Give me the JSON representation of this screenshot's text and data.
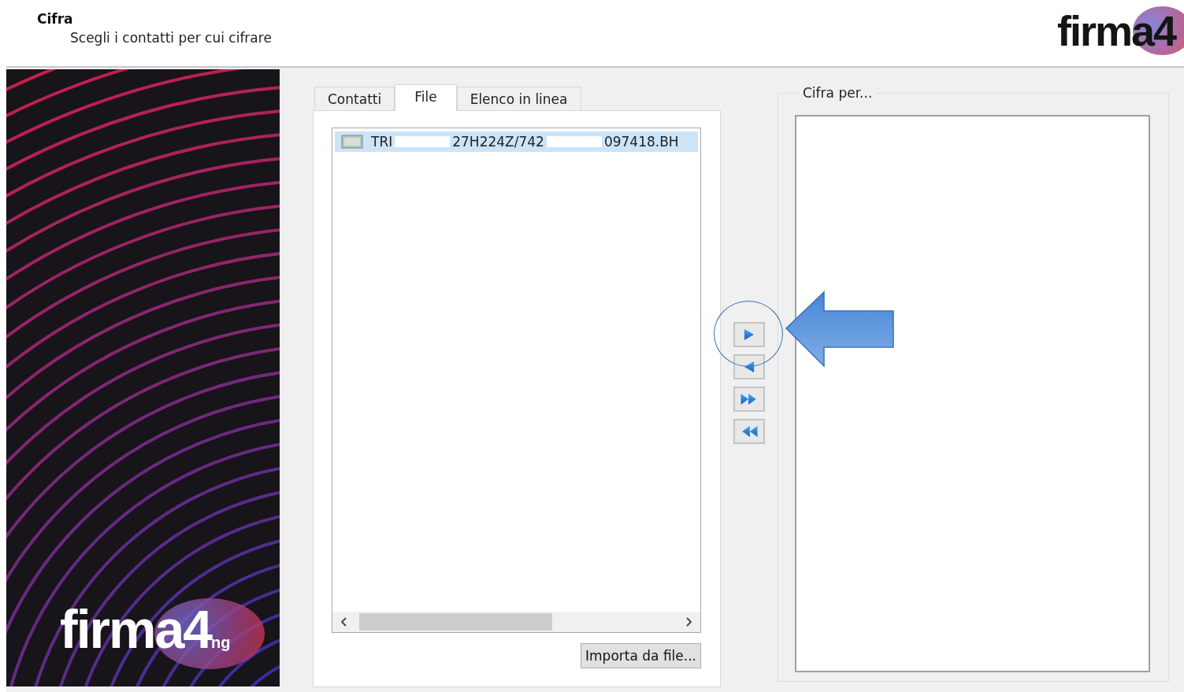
{
  "header": {
    "title": "Cifra",
    "subtitle": "Scegli i contatti per cui cifrare",
    "logo": {
      "text": "firma4"
    }
  },
  "banner": {
    "logo": {
      "text": "firma4",
      "suffix": "ng"
    }
  },
  "tabs": [
    {
      "label": "Contatti",
      "selected": false
    },
    {
      "label": "File",
      "selected": true
    },
    {
      "label": "Elenco in linea",
      "selected": false
    }
  ],
  "file_list": {
    "items": [
      {
        "parts": [
          "TRI",
          "27H224Z/742",
          "097418.BH"
        ],
        "selected": true
      }
    ]
  },
  "import_button": "Importa da file...",
  "transfer_buttons": [
    {
      "kind": "add"
    },
    {
      "kind": "remove"
    },
    {
      "kind": "add-all"
    },
    {
      "kind": "remove-all"
    }
  ],
  "recipients": {
    "title": "Cifra per..."
  }
}
